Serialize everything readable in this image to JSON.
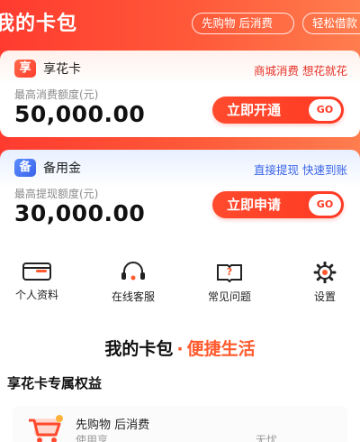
{
  "header": {
    "title": "我的卡包",
    "pills": [
      "先购物 后消费",
      "轻松借款"
    ]
  },
  "cards": [
    {
      "icon_glyph": "享",
      "name": "享花卡",
      "tag": "商城消费 想花就花",
      "subtitle": "最高消费额度(元)",
      "amount": "50,000.00",
      "button_label": "立即开通",
      "go_label": "GO"
    },
    {
      "icon_glyph": "备",
      "name": "备用金",
      "tag": "直接提现 快速到账",
      "subtitle": "最高提现额度(元)",
      "amount": "30,000.00",
      "button_label": "立即申请",
      "go_label": "GO"
    }
  ],
  "quick_actions": [
    {
      "label": "个人资料",
      "icon": "id-card-icon"
    },
    {
      "label": "在线客服",
      "icon": "headset-icon"
    },
    {
      "label": "常见问题",
      "icon": "question-book-icon"
    },
    {
      "label": "设置",
      "icon": "gear-icon"
    }
  ],
  "slogan": {
    "part_a": "我的卡包",
    "dot": "·",
    "part_b": "便捷生活"
  },
  "benefits": {
    "title": "享花卡专属权益",
    "items": [
      {
        "title": "先购物 后消费",
        "desc_start": "使用享",
        "desc_end": "无忧",
        "icon": "shopping-cart-icon"
      }
    ]
  },
  "colors": {
    "brand_red": "#ff3b2f",
    "accent_orange": "#ff5a2d",
    "blue": "#3a64e8"
  }
}
